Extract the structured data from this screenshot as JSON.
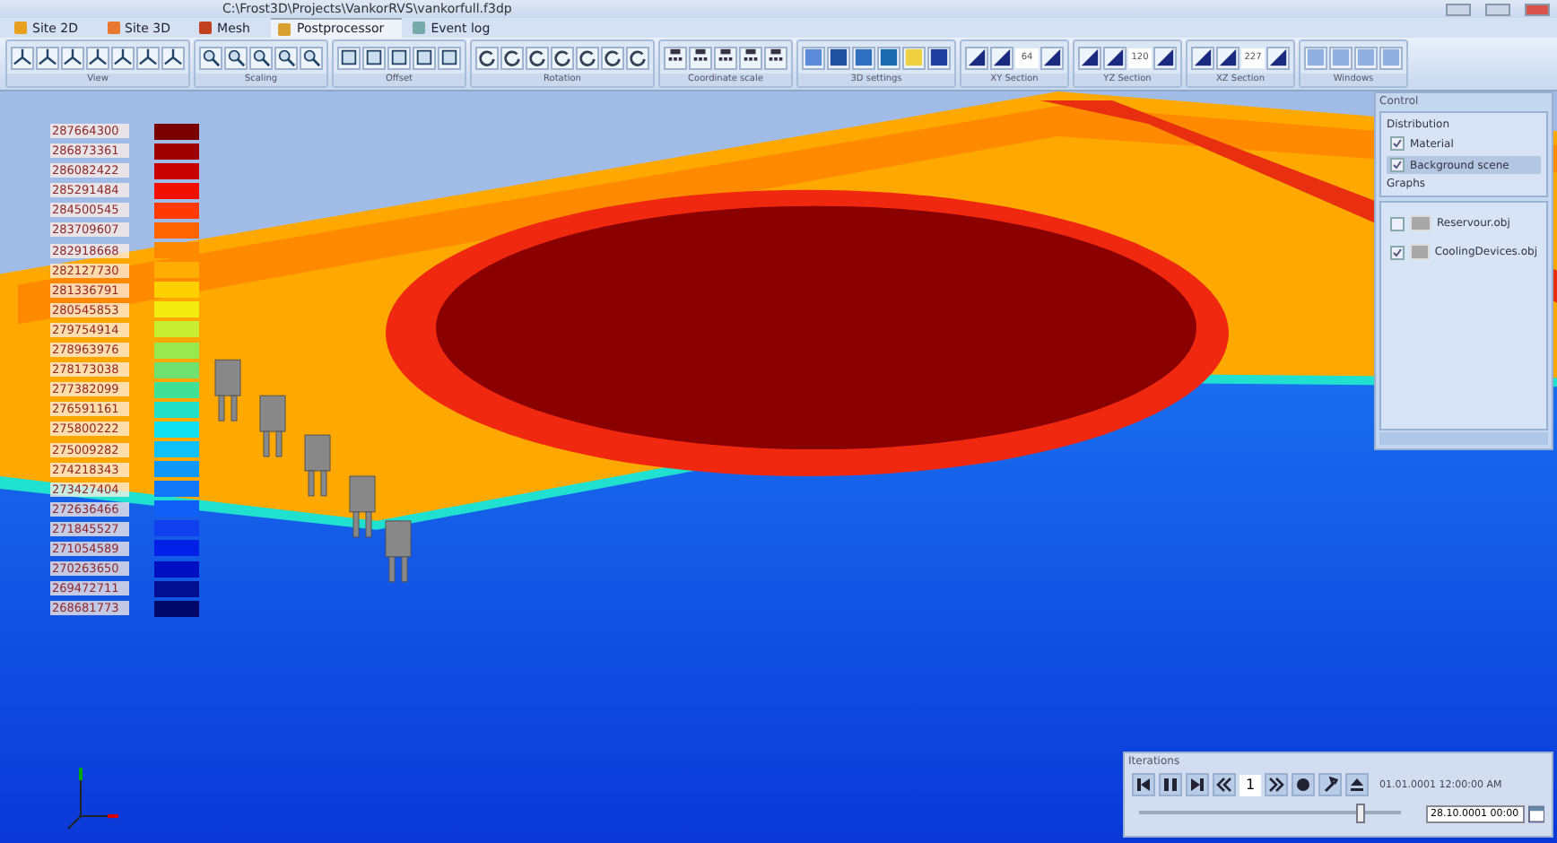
{
  "window": {
    "title": "C:\\Frost3D\\Projects\\VankorRVS\\vankorfull.f3dp"
  },
  "tabs": [
    {
      "label": "Site 2D",
      "selected": false
    },
    {
      "label": "Site 3D",
      "selected": false
    },
    {
      "label": "Mesh",
      "selected": false
    },
    {
      "label": "Postprocessor",
      "selected": true
    },
    {
      "label": "Event log",
      "selected": false
    }
  ],
  "toolbar": {
    "groups": [
      {
        "label": "View",
        "kind": "view"
      },
      {
        "label": "Scaling",
        "kind": "scaling"
      },
      {
        "label": "Offset",
        "kind": "offset"
      },
      {
        "label": "Rotation",
        "kind": "rotation"
      },
      {
        "label": "Coordinate scale",
        "kind": "coords"
      },
      {
        "label": "3D settings",
        "kind": "settings3d"
      },
      {
        "label": "XY Section",
        "kind": "section",
        "value": "64"
      },
      {
        "label": "YZ Section",
        "kind": "section",
        "value": "120"
      },
      {
        "label": "XZ Section",
        "kind": "section",
        "value": "227"
      },
      {
        "label": "Windows",
        "kind": "windows"
      }
    ]
  },
  "legend": [
    {
      "value": "287664300",
      "color": "#7a0000"
    },
    {
      "value": "286873361",
      "color": "#9e0000"
    },
    {
      "value": "286082422",
      "color": "#c80000"
    },
    {
      "value": "285291484",
      "color": "#f01000"
    },
    {
      "value": "284500545",
      "color": "#ff3a00"
    },
    {
      "value": "283709607",
      "color": "#ff6400"
    },
    {
      "value": "282918668",
      "color": "#ff8a00"
    },
    {
      "value": "282127730",
      "color": "#ffae00"
    },
    {
      "value": "281336791",
      "color": "#ffd000"
    },
    {
      "value": "280545853",
      "color": "#f4ec10"
    },
    {
      "value": "279754914",
      "color": "#c8ec30"
    },
    {
      "value": "278963976",
      "color": "#98e850"
    },
    {
      "value": "278173038",
      "color": "#70e070"
    },
    {
      "value": "277382099",
      "color": "#40e098"
    },
    {
      "value": "276591161",
      "color": "#20e0c8"
    },
    {
      "value": "275800222",
      "color": "#10e0f0"
    },
    {
      "value": "275009282",
      "color": "#10c0f8"
    },
    {
      "value": "274218343",
      "color": "#1098f8"
    },
    {
      "value": "273427404",
      "color": "#1078f8"
    },
    {
      "value": "272636466",
      "color": "#1060f8"
    },
    {
      "value": "271845527",
      "color": "#1040f0"
    },
    {
      "value": "271054589",
      "color": "#0020e8"
    },
    {
      "value": "270263650",
      "color": "#0010c0"
    },
    {
      "value": "269472711",
      "color": "#001090"
    },
    {
      "value": "268681773",
      "color": "#000868"
    }
  ],
  "control": {
    "title": "Control",
    "section": "Distribution",
    "options": [
      {
        "label": "Material",
        "checked": true,
        "selected": false
      },
      {
        "label": "Background scene",
        "checked": true,
        "selected": true
      }
    ],
    "graphs_title": "Graphs",
    "objects": [
      {
        "label": "Reservour.obj",
        "checked": false
      },
      {
        "label": "CoolingDevices.obj",
        "checked": true
      }
    ]
  },
  "iterations": {
    "title": "Iterations",
    "step": "1",
    "current_time": "01.01.0001 12:00:00 AM",
    "level": 0.83,
    "end_date": "28.10.0001 00:00"
  }
}
